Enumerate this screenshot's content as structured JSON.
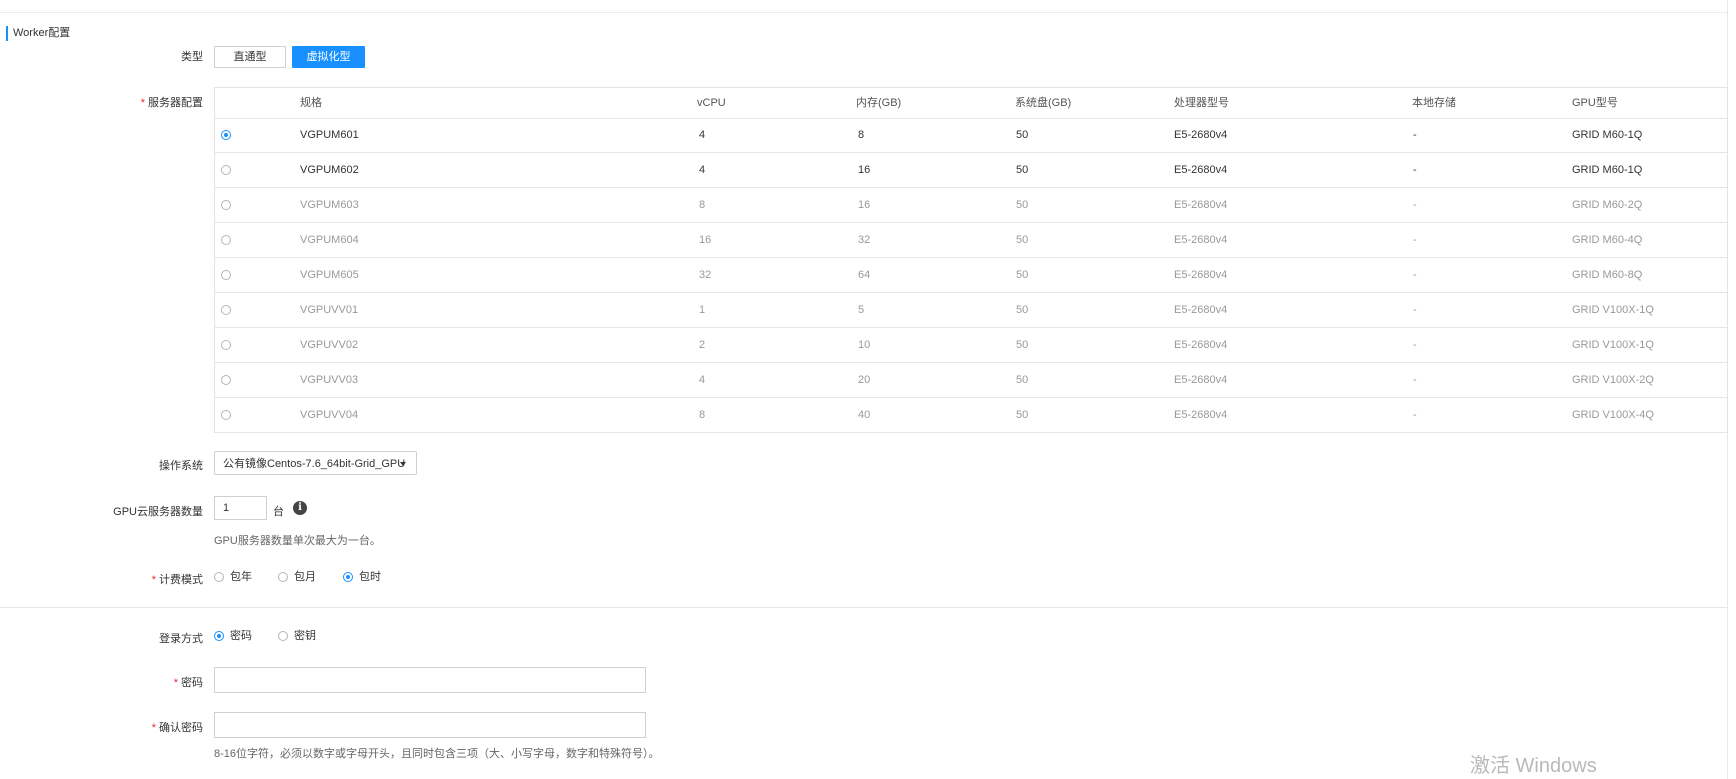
{
  "section_title": "Worker配置",
  "type_label": "类型",
  "type_options": [
    "直通型",
    "虚拟化型"
  ],
  "type_selected": "虚拟化型",
  "server_config_label": "服务器配置",
  "table": {
    "headers": [
      "规格",
      "vCPU",
      "内存(GB)",
      "系统盘(GB)",
      "处理器型号",
      "本地存储",
      "GPU型号"
    ],
    "rows": [
      {
        "spec": "VGPUM601",
        "vcpu": "4",
        "mem": "8",
        "disk": "50",
        "cpu": "E5-2680v4",
        "storage": "-",
        "gpu": "GRID M60-1Q",
        "selected": true,
        "dim": false
      },
      {
        "spec": "VGPUM602",
        "vcpu": "4",
        "mem": "16",
        "disk": "50",
        "cpu": "E5-2680v4",
        "storage": "-",
        "gpu": "GRID M60-1Q",
        "selected": false,
        "dim": false
      },
      {
        "spec": "VGPUM603",
        "vcpu": "8",
        "mem": "16",
        "disk": "50",
        "cpu": "E5-2680v4",
        "storage": "-",
        "gpu": "GRID M60-2Q",
        "selected": false,
        "dim": true
      },
      {
        "spec": "VGPUM604",
        "vcpu": "16",
        "mem": "32",
        "disk": "50",
        "cpu": "E5-2680v4",
        "storage": "-",
        "gpu": "GRID M60-4Q",
        "selected": false,
        "dim": true
      },
      {
        "spec": "VGPUM605",
        "vcpu": "32",
        "mem": "64",
        "disk": "50",
        "cpu": "E5-2680v4",
        "storage": "-",
        "gpu": "GRID M60-8Q",
        "selected": false,
        "dim": true
      },
      {
        "spec": "VGPUVV01",
        "vcpu": "1",
        "mem": "5",
        "disk": "50",
        "cpu": "E5-2680v4",
        "storage": "-",
        "gpu": "GRID V100X-1Q",
        "selected": false,
        "dim": true
      },
      {
        "spec": "VGPUVV02",
        "vcpu": "2",
        "mem": "10",
        "disk": "50",
        "cpu": "E5-2680v4",
        "storage": "-",
        "gpu": "GRID V100X-1Q",
        "selected": false,
        "dim": true
      },
      {
        "spec": "VGPUVV03",
        "vcpu": "4",
        "mem": "20",
        "disk": "50",
        "cpu": "E5-2680v4",
        "storage": "-",
        "gpu": "GRID V100X-2Q",
        "selected": false,
        "dim": true
      },
      {
        "spec": "VGPUVV04",
        "vcpu": "8",
        "mem": "40",
        "disk": "50",
        "cpu": "E5-2680v4",
        "storage": "-",
        "gpu": "GRID V100X-4Q",
        "selected": false,
        "dim": true
      }
    ]
  },
  "os_label": "操作系统",
  "os_value": "公有镜像Centos-7.6_64bit-Grid_GPU",
  "count_label": "GPU云服务器数量",
  "count_value": "1",
  "count_unit": "台",
  "count_hint": "GPU服务器数量单次最大为一台。",
  "billing_label": "计费模式",
  "billing_options": [
    "包年",
    "包月",
    "包时"
  ],
  "billing_selected": "包时",
  "login_label": "登录方式",
  "login_options": [
    "密码",
    "密钥"
  ],
  "login_selected": "密码",
  "password_label": "密码",
  "confirm_label": "确认密码",
  "password_hint": "8-16位字符，必须以数字或字母开头，且同时包含三项（大、小写字母，数字和特殊符号）。",
  "required_mark": "*",
  "info_icon_text": "i",
  "watermark": "激活 Windows",
  "colors": {
    "accent": "#1890ff",
    "required": "#f5222d"
  }
}
